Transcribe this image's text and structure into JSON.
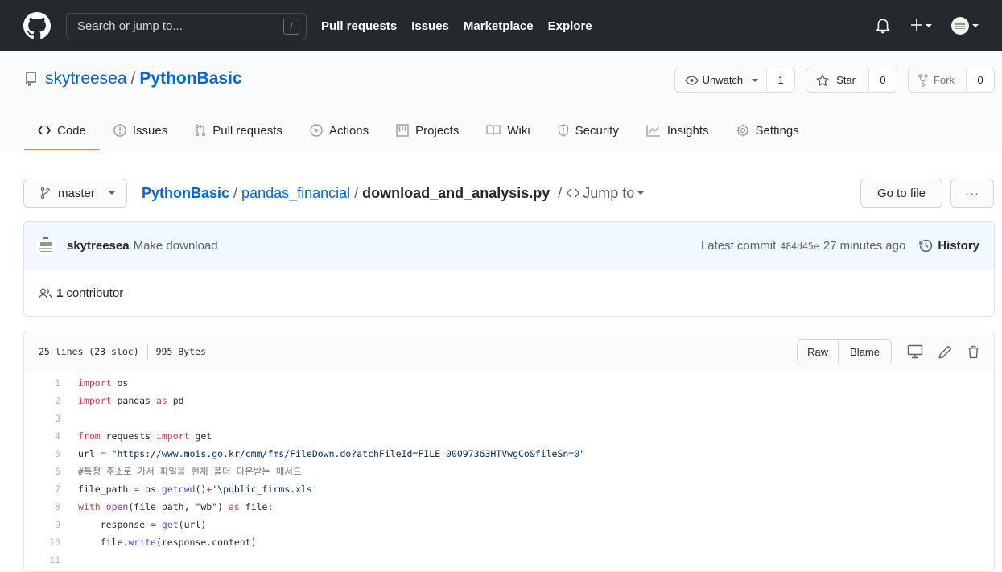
{
  "header": {
    "search_placeholder": "Search or jump to...",
    "search_shortcut": "/",
    "nav": [
      "Pull requests",
      "Issues",
      "Marketplace",
      "Explore"
    ]
  },
  "repo": {
    "owner": "skytreesea",
    "separator": "/",
    "name": "PythonBasic",
    "watch": {
      "label": "Unwatch",
      "count": "1"
    },
    "star": {
      "label": "Star",
      "count": "0"
    },
    "fork": {
      "label": "Fork",
      "count": "0"
    }
  },
  "tabs": [
    {
      "label": "Code",
      "icon": "code-icon",
      "active": true
    },
    {
      "label": "Issues",
      "icon": "issue-icon"
    },
    {
      "label": "Pull requests",
      "icon": "pull-request-icon"
    },
    {
      "label": "Actions",
      "icon": "play-icon"
    },
    {
      "label": "Projects",
      "icon": "project-icon"
    },
    {
      "label": "Wiki",
      "icon": "book-icon"
    },
    {
      "label": "Security",
      "icon": "shield-icon"
    },
    {
      "label": "Insights",
      "icon": "graph-icon"
    },
    {
      "label": "Settings",
      "icon": "gear-icon"
    }
  ],
  "file_nav": {
    "branch": "master",
    "breadcrumb": [
      "PythonBasic",
      "pandas_financial",
      "download_and_analysis.py"
    ],
    "jump_to": "Jump to",
    "go_to_file": "Go to file",
    "more": "···"
  },
  "commit": {
    "author": "skytreesea",
    "message": "Make download",
    "latest_label": "Latest commit",
    "sha": "484d45e",
    "time": "27 minutes ago",
    "history": "History"
  },
  "contributors": {
    "count": "1",
    "label": "contributor"
  },
  "file": {
    "lines_info": "25 lines (23 sloc)",
    "size": "995 Bytes",
    "raw": "Raw",
    "blame": "Blame"
  },
  "code_lines": [
    {
      "n": "1",
      "html": "<span class='k'>import</span> os"
    },
    {
      "n": "2",
      "html": "<span class='k'>import</span> pandas <span class='k'>as</span> pd"
    },
    {
      "n": "3",
      "html": ""
    },
    {
      "n": "4",
      "html": "<span class='k'>from</span> requests <span class='k'>import</span> get"
    },
    {
      "n": "5",
      "html": "url <span class='k'>=</span> <span class='s'>\"https://www.mois.go.kr/cmm/fms/FileDown.do?atchFileId=FILE_00097363HTVwgCo&amp;fileSn=0\"</span>"
    },
    {
      "n": "6",
      "html": "<span class='c'>#특정 주소로 가서 파일을 현재 폴더 다운받는 매서드</span>"
    },
    {
      "n": "7",
      "html": "file_path <span class='k'>=</span> os.<span class='f'>getcwd</span>()<span class='k'>+</span><span class='s'>'\\public_firms.xls'</span>"
    },
    {
      "n": "8",
      "html": "<span class='k'>with</span> <span class='f'>open</span>(file_path, <span class='s'>\"wb\"</span>) <span class='k'>as</span> file:"
    },
    {
      "n": "9",
      "html": "    response <span class='k'>=</span> <span class='f'>get</span>(url)"
    },
    {
      "n": "10",
      "html": "    file.<span class='f'>write</span>(response.content)"
    },
    {
      "n": "11",
      "html": ""
    }
  ]
}
